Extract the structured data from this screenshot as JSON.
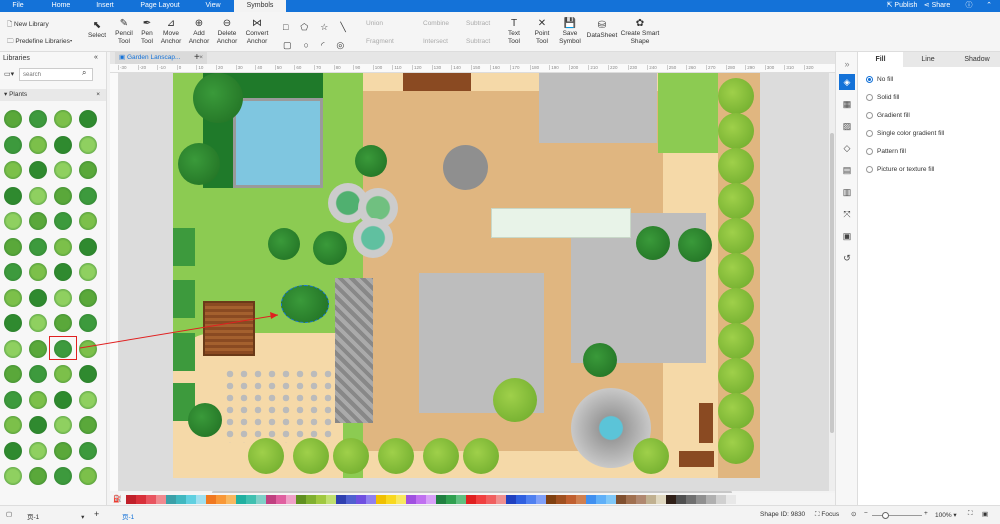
{
  "menu": {
    "tabs": [
      "File",
      "Home",
      "Insert",
      "Page Layout",
      "View",
      "Symbols"
    ],
    "active": "Symbols",
    "publish": "Publish",
    "share": "Share"
  },
  "ribbon": {
    "new_library": "New Library",
    "predefine_libraries": "Predefine Libraries",
    "select": "Select",
    "pencil": "Pencil Tool",
    "pen": "Pen Tool",
    "move_anchor": "Move Anchor",
    "add_anchor": "Add Anchor",
    "delete_anchor": "Delete Anchor",
    "convert_anchor": "Convert Anchor",
    "union": "Union",
    "combine": "Combine",
    "subtract": "Subtract",
    "fragment": "Fragment",
    "intersect": "Intersect",
    "subtract2": "Subtract",
    "text_tool": "Text Tool",
    "point_tool": "Point Tool",
    "save_symbol": "Save Symbol",
    "datasheet": "DataSheet",
    "smart_shape": "Create Smart Shape"
  },
  "libraries": {
    "title": "Libraries",
    "search_placeholder": "search",
    "category": "Plants"
  },
  "document": {
    "tab": "Garden Lanscap..."
  },
  "ruler": {
    "ticks": [
      "-30",
      "-20",
      "-10",
      "0",
      "10",
      "20",
      "30",
      "40",
      "50",
      "60",
      "70",
      "80",
      "90",
      "100",
      "110",
      "120",
      "130",
      "140",
      "150",
      "160",
      "170",
      "180",
      "190",
      "200",
      "210",
      "220",
      "230",
      "240",
      "250",
      "260",
      "270",
      "280",
      "290",
      "300",
      "310",
      "320"
    ]
  },
  "panel": {
    "tabs": [
      "Fill",
      "Line",
      "Shadow"
    ],
    "active": "Fill",
    "options": [
      "No fill",
      "Solid fill",
      "Gradient fill",
      "Single color gradient fill",
      "Pattern fill",
      "Picture or texture fill"
    ],
    "selected": "No fill"
  },
  "palette": [
    "#c0202a",
    "#d8303a",
    "#e85560",
    "#f08a90",
    "#3aa0a8",
    "#40b8c0",
    "#60d0e0",
    "#a0e0f0",
    "#f07820",
    "#f89838",
    "#f8b860",
    "#20b0a0",
    "#40c0b0",
    "#80d0c8",
    "#c04080",
    "#e060a0",
    "#f0a0c8",
    "#609020",
    "#80b030",
    "#a0c840",
    "#c0e070",
    "#3040b0",
    "#5060d0",
    "#7050e0",
    "#9080f0",
    "#f0c000",
    "#f8d820",
    "#f8e860",
    "#a050e0",
    "#c070f0",
    "#d8a0f8",
    "#208040",
    "#30a050",
    "#60c080",
    "#e02020",
    "#f04040",
    "#f06060",
    "#f09090",
    "#2040c0",
    "#3060e0",
    "#5080f0",
    "#80a0f8",
    "#804010",
    "#a05020",
    "#c06030",
    "#d08050",
    "#4090f0",
    "#60b0f8",
    "#80c8f8",
    "#805030",
    "#a07050",
    "#b08870",
    "#c0b090",
    "#e0d8c0",
    "#302018",
    "#505050",
    "#707070",
    "#909090",
    "#b0b0b0",
    "#d0d0d0",
    "#e8e8e8"
  ],
  "status": {
    "page_left": "页-1",
    "page_tab": "页-1",
    "shape_id": "Shape ID: 9830",
    "focus": "Focus",
    "zoom": "100%"
  }
}
